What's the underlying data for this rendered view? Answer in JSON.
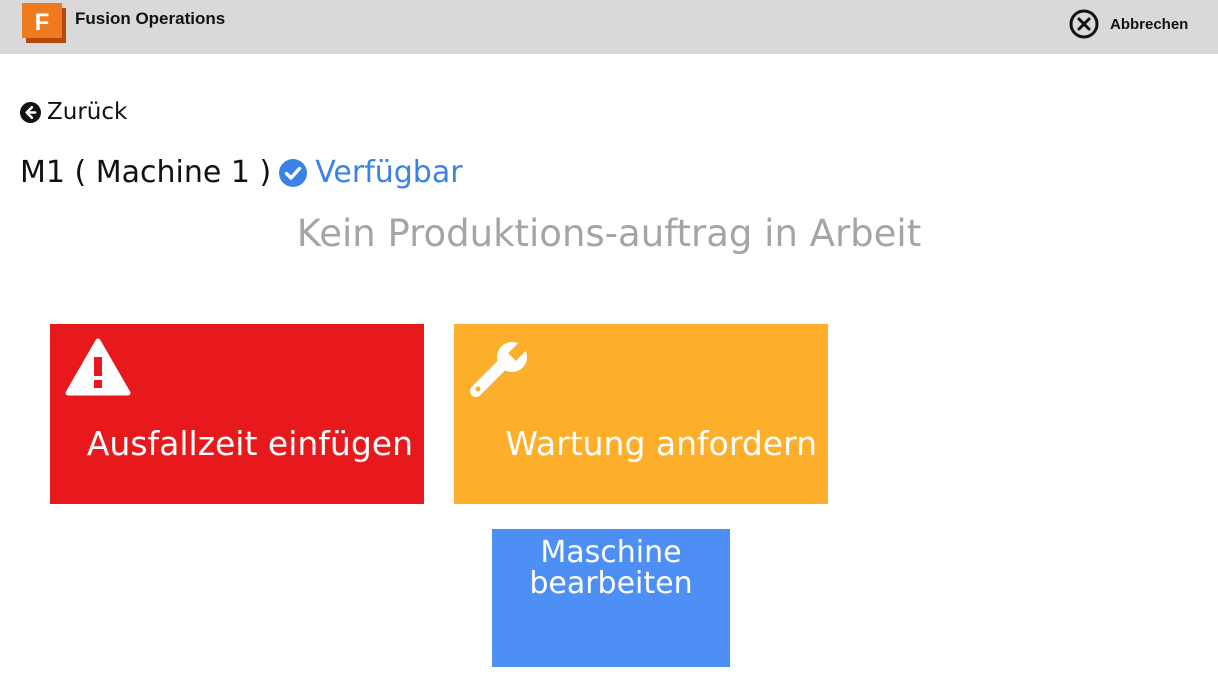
{
  "header": {
    "logo_letter": "F",
    "app_title": "Fusion Operations",
    "cancel_label": "Abbrechen",
    "cancel_icon": "close-circle-icon",
    "background_color": "#d9d9d9"
  },
  "nav": {
    "back_label": "Zurück",
    "back_icon": "arrow-left-circle-icon"
  },
  "machine": {
    "name": "M1 ( Machine 1 )",
    "status_label": "Verfügbar",
    "status_icon": "check-circle-icon",
    "status_color": "#3b82e6"
  },
  "main": {
    "headline": "Kein Produktions-auftrag in Arbeit"
  },
  "actions": {
    "downtime": {
      "label": "Ausfallzeit einfügen",
      "icon": "warning-icon",
      "color": "#e8191d"
    },
    "maintenance": {
      "label": "Wartung anfordern",
      "icon": "wrench-icon",
      "color": "#fdae2a"
    },
    "edit_machine": {
      "label_line1": "Maschine",
      "label_line2": "bearbeiten",
      "color": "#4e8ff5"
    }
  }
}
